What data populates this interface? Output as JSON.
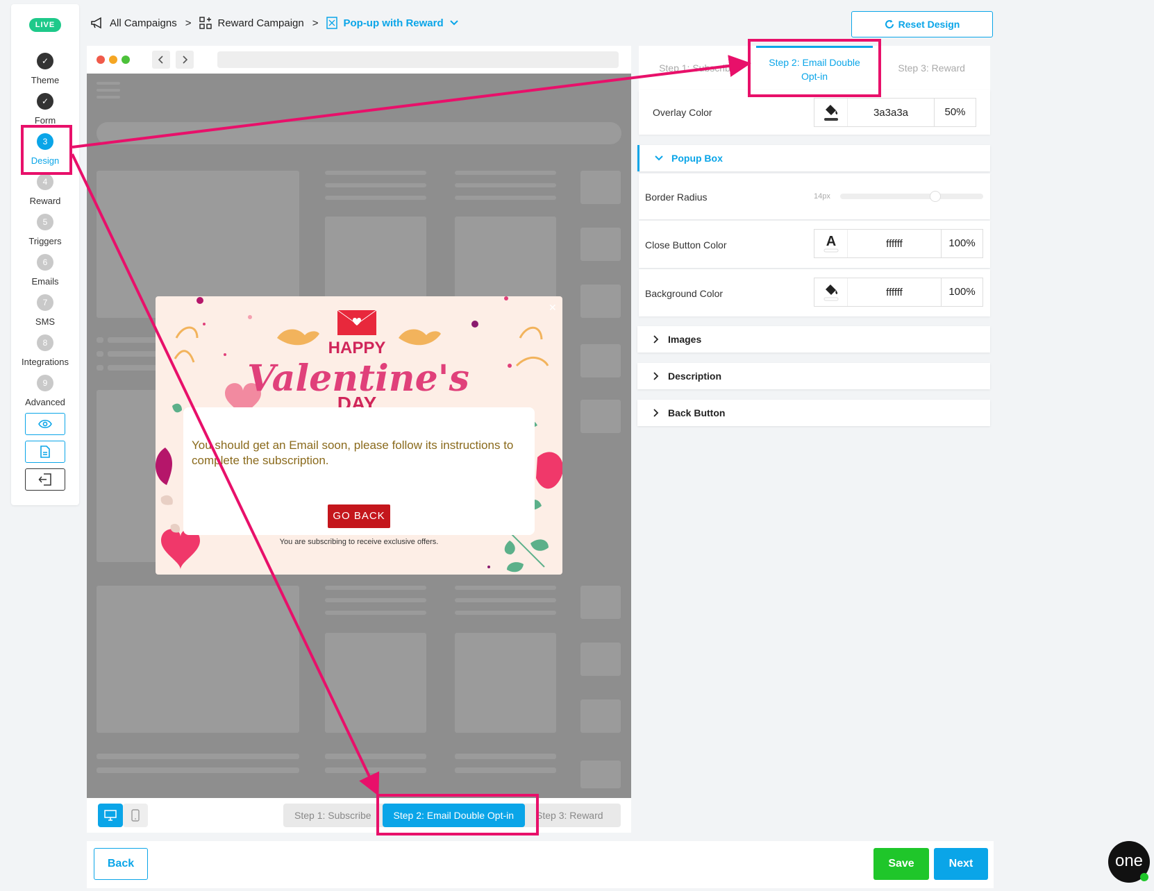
{
  "live_badge": "LIVE",
  "steps": [
    {
      "num": "",
      "label": "Theme",
      "state": "done"
    },
    {
      "num": "",
      "label": "Form",
      "state": "done"
    },
    {
      "num": "3",
      "label": "Design",
      "state": "active"
    },
    {
      "num": "4",
      "label": "Reward",
      "state": "todo"
    },
    {
      "num": "5",
      "label": "Triggers",
      "state": "todo"
    },
    {
      "num": "6",
      "label": "Emails",
      "state": "todo"
    },
    {
      "num": "7",
      "label": "SMS",
      "state": "todo"
    },
    {
      "num": "8",
      "label": "Integrations",
      "state": "todo"
    },
    {
      "num": "9",
      "label": "Advanced",
      "state": "todo"
    }
  ],
  "breadcrumb": {
    "all_campaigns": "All Campaigns",
    "sep": ">",
    "reward_campaign": "Reward Campaign",
    "current": "Pop-up with Reward"
  },
  "reset_design": "Reset Design",
  "popup": {
    "message": "You should get an Email soon, please follow its instructions to complete the subscription.",
    "button": "GO BACK",
    "footer": "You are subscribing to receive exclusive offers.",
    "art_title_small": "HAPPY",
    "art_title_big": "Valentine's",
    "art_title_day": "DAY"
  },
  "preview_steps": [
    "Step 1: Subscribe",
    "Step 2: Email Double Opt-in",
    "Step 3: Reward"
  ],
  "panel_tabs": [
    "Step 1: Subscribe",
    "Step 2: Email Double Opt-in",
    "Step 3: Reward"
  ],
  "overlay": {
    "label": "Overlay Color",
    "hex": "3a3a3a",
    "opacity": "50%"
  },
  "popup_box": {
    "title": "Popup Box",
    "border_radius": {
      "label": "Border Radius",
      "value": "14px",
      "fraction": 0.68
    },
    "close_button_color": {
      "label": "Close Button Color",
      "hex": "ffffff",
      "opacity": "100%"
    },
    "background_color": {
      "label": "Background Color",
      "hex": "ffffff",
      "opacity": "100%"
    }
  },
  "sections": [
    "Images",
    "Description",
    "Back Button"
  ],
  "footer": {
    "back": "Back",
    "save": "Save",
    "next": "Next"
  },
  "brand_logo": "one",
  "colors": {
    "accent": "#0aa5e8",
    "save": "#1fc62a",
    "annotation": "#e8106a",
    "go_back": "#c4161c"
  }
}
